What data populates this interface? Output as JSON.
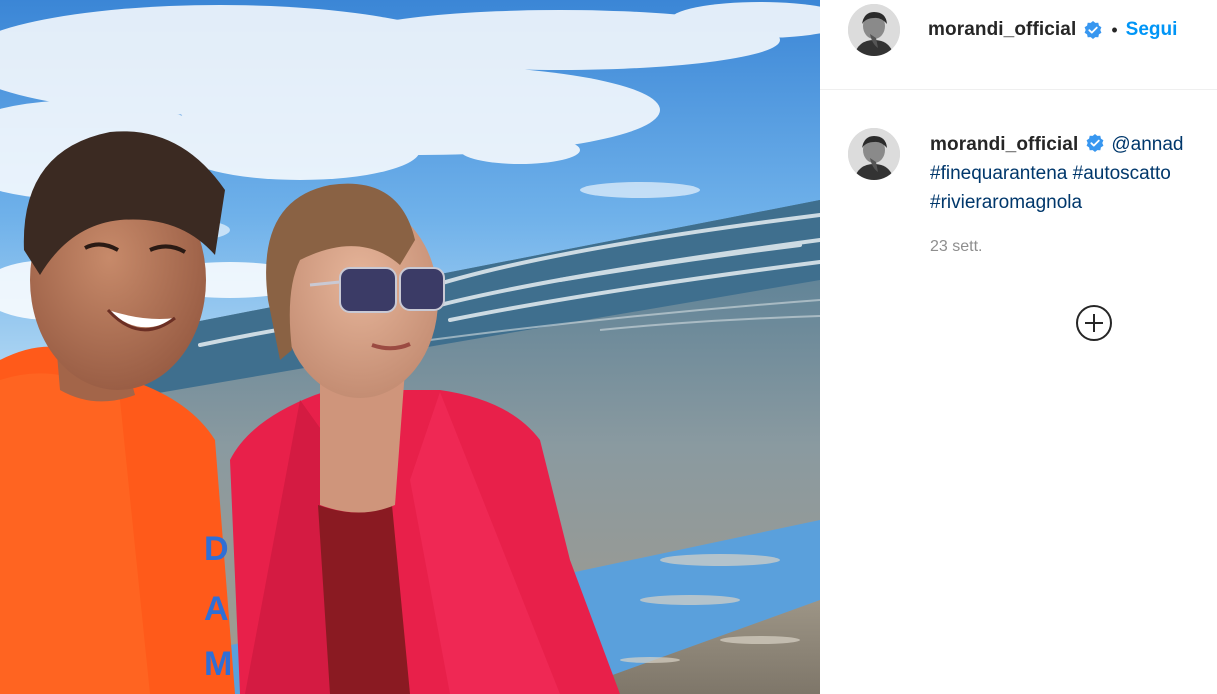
{
  "post": {
    "username": "morandi_official",
    "separator": "•",
    "follow_label": "Segui",
    "verified_icon": "verified-badge-icon",
    "accent_color": "#0095f6",
    "link_color": "#00376b"
  },
  "caption": {
    "username": "morandi_official",
    "mention": "@annad",
    "line1_hashtags": "#finequarantena #autoscatto",
    "line2_hashtags": "#rivieraromagnola",
    "timestamp": "23 sett."
  },
  "actions": {
    "add_icon": "plus-circle-icon"
  },
  "photo": {
    "letters": [
      "D",
      "A",
      "M"
    ]
  }
}
